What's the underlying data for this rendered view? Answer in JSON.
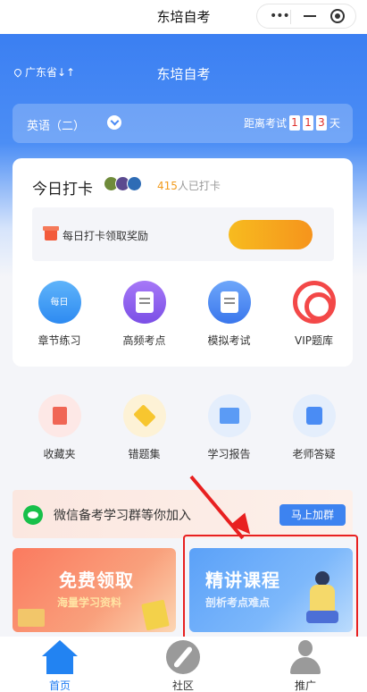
{
  "window": {
    "title": "东培自考"
  },
  "header": {
    "location": "广东省↓↑",
    "title": "东培自考"
  },
  "exam": {
    "subject": "英语（二）",
    "countdown_label": "距离考试",
    "digits": [
      "1",
      "1",
      "3"
    ],
    "unit": "天"
  },
  "checkin": {
    "title": "今日打卡",
    "count": "415",
    "count_suffix": "人已打卡",
    "reward_text": "每日打卡领取奖励"
  },
  "practice": [
    {
      "label": "章节练习",
      "icon": "chapter-icon",
      "mini": "每日"
    },
    {
      "label": "高频考点",
      "icon": "clipboard-icon"
    },
    {
      "label": "模拟考试",
      "icon": "document-icon"
    },
    {
      "label": "VIP题库",
      "icon": "target-icon"
    }
  ],
  "tools": [
    {
      "label": "收藏夹",
      "icon": "bookmark-icon"
    },
    {
      "label": "错题集",
      "icon": "wrong-set-icon"
    },
    {
      "label": "学习报告",
      "icon": "report-icon"
    },
    {
      "label": "老师答疑",
      "icon": "question-icon"
    }
  ],
  "wechat": {
    "text": "微信备考学习群等你加入",
    "button": "马上加群"
  },
  "promos": {
    "free": {
      "title": "免费领取",
      "subtitle": "海量学习资料"
    },
    "course": {
      "title": "精讲课程",
      "subtitle": "剖析考点难点"
    }
  },
  "tabbar": [
    {
      "label": "首页",
      "icon": "home-icon",
      "active": true
    },
    {
      "label": "社区",
      "icon": "compass-icon",
      "active": false
    },
    {
      "label": "推广",
      "icon": "person-icon",
      "active": false
    }
  ],
  "colors": {
    "accent": "#2283f2",
    "highlight": "#e82020",
    "countdown_digit": "#e0312a",
    "checkin_count": "#f29b1c"
  }
}
